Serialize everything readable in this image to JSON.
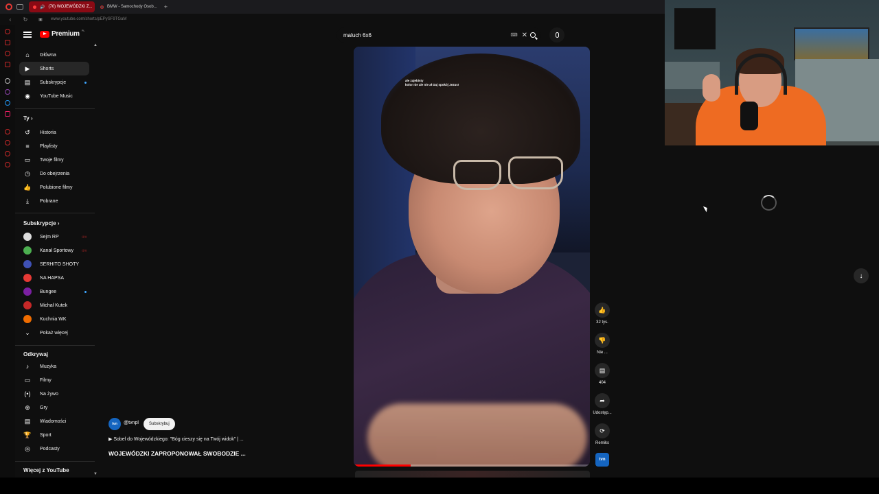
{
  "browser": {
    "tabs": [
      {
        "label": "(70) WOJEWÓDZKI Z..."
      },
      {
        "label": "BMW - Samochody Osob..."
      }
    ],
    "new_tab": "+",
    "url": "www.youtube.com/shorts/pEPySF9TGaM"
  },
  "header": {
    "logo_text": "Premium",
    "logo_region": "PL",
    "search_value": "maluch 6x6"
  },
  "sidebar": {
    "main": [
      {
        "label": "Główna",
        "icon": "home-icon"
      },
      {
        "label": "Shorts",
        "icon": "shorts-icon"
      },
      {
        "label": "Subskrypcje",
        "icon": "subscriptions-icon"
      },
      {
        "label": "YouTube Music",
        "icon": "music-icon"
      }
    ],
    "you_heading": "Ty",
    "you": [
      {
        "label": "Historia",
        "icon": "history-icon"
      },
      {
        "label": "Playlisty",
        "icon": "playlist-icon"
      },
      {
        "label": "Twoje filmy",
        "icon": "your-videos-icon"
      },
      {
        "label": "Do obejrzenia",
        "icon": "watch-later-icon"
      },
      {
        "label": "Polubione filmy",
        "icon": "like-icon"
      },
      {
        "label": "Pobrane",
        "icon": "download-icon"
      }
    ],
    "subs_heading": "Subskrypcje",
    "subs": [
      {
        "label": "Sejm RP",
        "color": "#dddddd"
      },
      {
        "label": "Kanał Sportowy",
        "color": "#4caf50"
      },
      {
        "label": "SERHITO SHOTY",
        "color": "#3f51b5"
      },
      {
        "label": "NA HAPSA",
        "color": "#e53935"
      },
      {
        "label": "Bungee",
        "color": "#7b1fa2"
      },
      {
        "label": "Michał Kutek",
        "color": "#c62828"
      },
      {
        "label": "Kuchnia WK",
        "color": "#ef6c00"
      }
    ],
    "show_more": "Pokaż więcej",
    "explore_heading": "Odkrywaj",
    "explore": [
      {
        "label": "Muzyka",
        "icon": "music-note-icon"
      },
      {
        "label": "Filmy",
        "icon": "film-icon"
      },
      {
        "label": "Na żywo",
        "icon": "live-icon"
      },
      {
        "label": "Gry",
        "icon": "gamepad-icon"
      },
      {
        "label": "Wiadomości",
        "icon": "news-icon"
      },
      {
        "label": "Sport",
        "icon": "trophy-icon"
      },
      {
        "label": "Podcasty",
        "icon": "podcast-icon"
      }
    ],
    "more_heading": "Więcej z YouTube"
  },
  "video": {
    "overlay_lines": [
      "ale zajebisty",
      "kolor nie ale nie ał Daj spokój Jezus!"
    ],
    "progress": 0.24
  },
  "actions": {
    "likes": "32 tys.",
    "dislike": "Nie ...",
    "comments": "404",
    "share": "Udostęp...",
    "remix": "Remiks"
  },
  "channel": {
    "avatar_text": "tvn",
    "handle": "@tvnpl",
    "subscribe": "Subskrybuj",
    "description": "▶ Sobel do Wojewódzkiego: \"Bóg cieszy się na Twój widok\" | ...",
    "title": "WOJEWÓDZKI ZAPROPONOWAŁ SWOBODZIE ..."
  }
}
